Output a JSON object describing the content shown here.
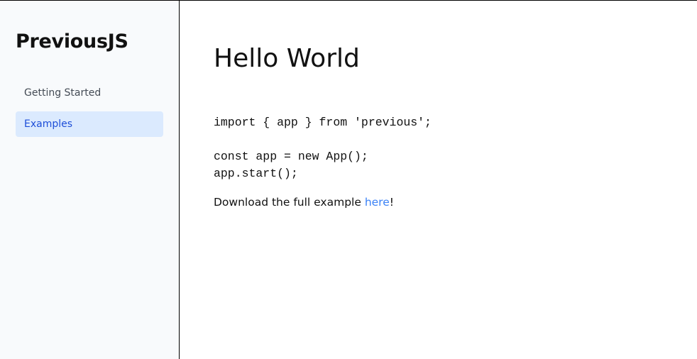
{
  "sidebar": {
    "brand": "PreviousJS",
    "items": [
      {
        "label": "Getting Started",
        "active": false
      },
      {
        "label": "Examples",
        "active": true
      }
    ]
  },
  "main": {
    "title": "Hello World",
    "code_lines": [
      "import { app } from 'previous';",
      "",
      "const app = new App();",
      "app.start();"
    ],
    "download_prefix": "Download the full example ",
    "download_link": "here",
    "download_suffix": "!"
  },
  "colors": {
    "sidebar_bg": "#f8fafc",
    "active_bg": "#dbeafe",
    "active_text": "#1d4ed8",
    "link": "#3b82f6"
  }
}
